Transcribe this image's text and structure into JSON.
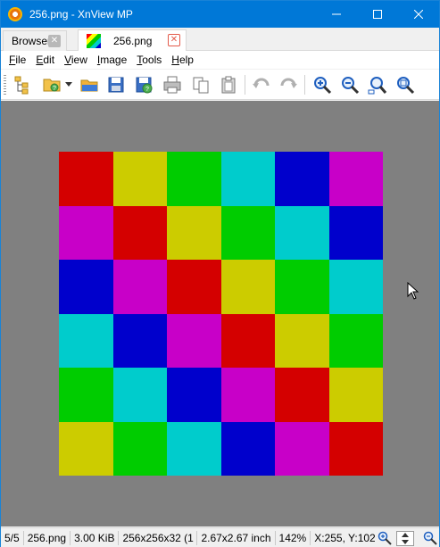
{
  "window": {
    "title": "256.png - XnView MP"
  },
  "titlebar_buttons": {
    "minimize": "—",
    "maximize": "☐",
    "close": "✕"
  },
  "tabs": [
    {
      "label": "Browser",
      "close": "✕"
    },
    {
      "label": "256.png",
      "close": "✕"
    }
  ],
  "menu": [
    {
      "label": "File",
      "key": "F"
    },
    {
      "label": "Edit",
      "key": "E"
    },
    {
      "label": "View",
      "key": "V"
    },
    {
      "label": "Image",
      "key": "I"
    },
    {
      "label": "Tools",
      "key": "T"
    },
    {
      "label": "Help",
      "key": "H"
    }
  ],
  "toolbar_icons": [
    "show-browser-icon",
    "open-folder-icon",
    "dropdown-arrow-icon",
    "browse-folder-icon",
    "save-icon",
    "save-as-icon",
    "print-icon",
    "copy-icon",
    "paste-icon",
    "undo-icon",
    "redo-icon",
    "zoom-in-icon",
    "zoom-out-icon",
    "zoom-fit-icon",
    "zoom-actual-icon"
  ],
  "image": {
    "colors": {
      "red": "#d40000",
      "yellow": "#cccc00",
      "green": "#00cc00",
      "cyan": "#00cccc",
      "blue": "#0000cc",
      "magenta": "#c800c8"
    },
    "rows": [
      [
        "red",
        "yellow",
        "green",
        "cyan",
        "blue",
        "magenta"
      ],
      [
        "magenta",
        "red",
        "yellow",
        "green",
        "cyan",
        "blue"
      ],
      [
        "blue",
        "magenta",
        "red",
        "yellow",
        "green",
        "cyan"
      ],
      [
        "cyan",
        "blue",
        "magenta",
        "red",
        "yellow",
        "green"
      ],
      [
        "green",
        "cyan",
        "blue",
        "magenta",
        "red",
        "yellow"
      ],
      [
        "yellow",
        "green",
        "cyan",
        "blue",
        "magenta",
        "red"
      ]
    ]
  },
  "viewer_background": "#808080",
  "status": {
    "index": "5/5",
    "filename": "256.png",
    "filesize": "3.00 KiB",
    "format": "256x256x32 (1",
    "dimensions": "2.67x2.67 inch",
    "zoom": "142%",
    "coords": "X:255, Y:102"
  }
}
